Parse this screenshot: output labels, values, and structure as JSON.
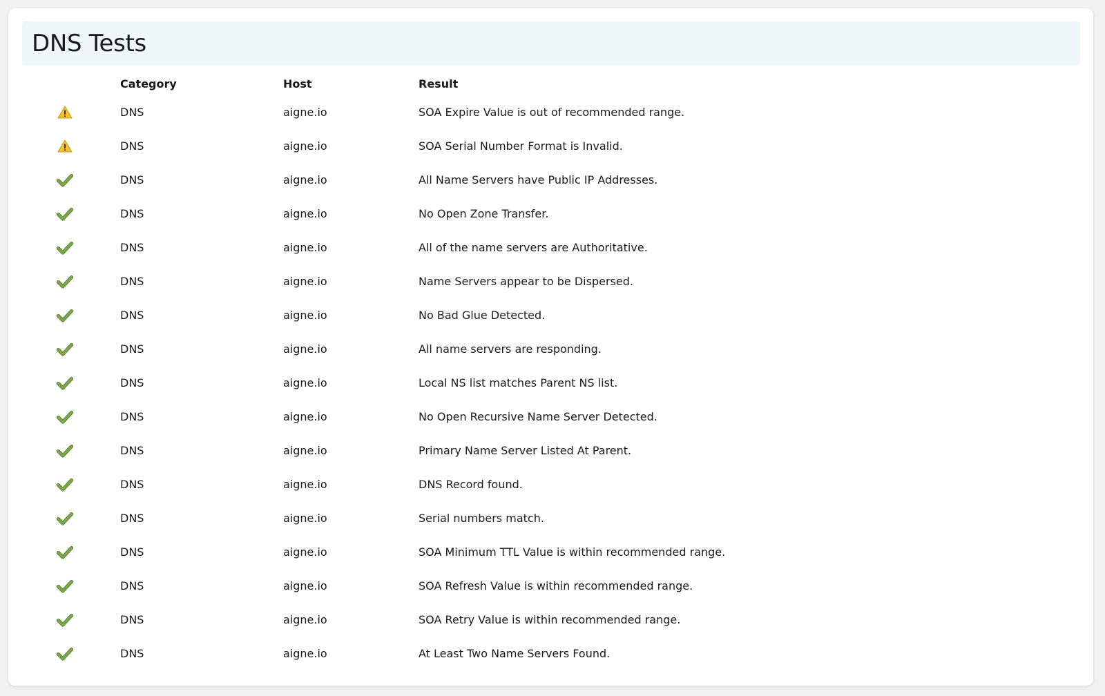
{
  "page": {
    "title": "DNS Tests"
  },
  "table": {
    "columns": [
      "Category",
      "Host",
      "Result"
    ],
    "rows": [
      {
        "status": "warning",
        "icon": "warning-icon",
        "category": "DNS",
        "host": "aigne.io",
        "result": "SOA Expire Value is out of recommended range."
      },
      {
        "status": "warning",
        "icon": "warning-icon",
        "category": "DNS",
        "host": "aigne.io",
        "result": "SOA Serial Number Format is Invalid."
      },
      {
        "status": "pass",
        "icon": "checkmark-icon",
        "category": "DNS",
        "host": "aigne.io",
        "result": "All Name Servers have Public IP Addresses."
      },
      {
        "status": "pass",
        "icon": "checkmark-icon",
        "category": "DNS",
        "host": "aigne.io",
        "result": "No Open Zone Transfer."
      },
      {
        "status": "pass",
        "icon": "checkmark-icon",
        "category": "DNS",
        "host": "aigne.io",
        "result": "All of the name servers are Authoritative."
      },
      {
        "status": "pass",
        "icon": "checkmark-icon",
        "category": "DNS",
        "host": "aigne.io",
        "result": "Name Servers appear to be Dispersed."
      },
      {
        "status": "pass",
        "icon": "checkmark-icon",
        "category": "DNS",
        "host": "aigne.io",
        "result": "No Bad Glue Detected."
      },
      {
        "status": "pass",
        "icon": "checkmark-icon",
        "category": "DNS",
        "host": "aigne.io",
        "result": "All name servers are responding."
      },
      {
        "status": "pass",
        "icon": "checkmark-icon",
        "category": "DNS",
        "host": "aigne.io",
        "result": "Local NS list matches Parent NS list."
      },
      {
        "status": "pass",
        "icon": "checkmark-icon",
        "category": "DNS",
        "host": "aigne.io",
        "result": "No Open Recursive Name Server Detected."
      },
      {
        "status": "pass",
        "icon": "checkmark-icon",
        "category": "DNS",
        "host": "aigne.io",
        "result": "Primary Name Server Listed At Parent."
      },
      {
        "status": "pass",
        "icon": "checkmark-icon",
        "category": "DNS",
        "host": "aigne.io",
        "result": "DNS Record found."
      },
      {
        "status": "pass",
        "icon": "checkmark-icon",
        "category": "DNS",
        "host": "aigne.io",
        "result": "Serial numbers match."
      },
      {
        "status": "pass",
        "icon": "checkmark-icon",
        "category": "DNS",
        "host": "aigne.io",
        "result": "SOA Minimum TTL Value is within recommended range."
      },
      {
        "status": "pass",
        "icon": "checkmark-icon",
        "category": "DNS",
        "host": "aigne.io",
        "result": "SOA Refresh Value is within recommended range."
      },
      {
        "status": "pass",
        "icon": "checkmark-icon",
        "category": "DNS",
        "host": "aigne.io",
        "result": "SOA Retry Value is within recommended range."
      },
      {
        "status": "pass",
        "icon": "checkmark-icon",
        "category": "DNS",
        "host": "aigne.io",
        "result": "At Least Two Name Servers Found."
      }
    ]
  },
  "colors": {
    "title_bar_bg": "#eef8fa",
    "check_green": "#7aa84a",
    "warning_yellow": "#f2c12e"
  }
}
